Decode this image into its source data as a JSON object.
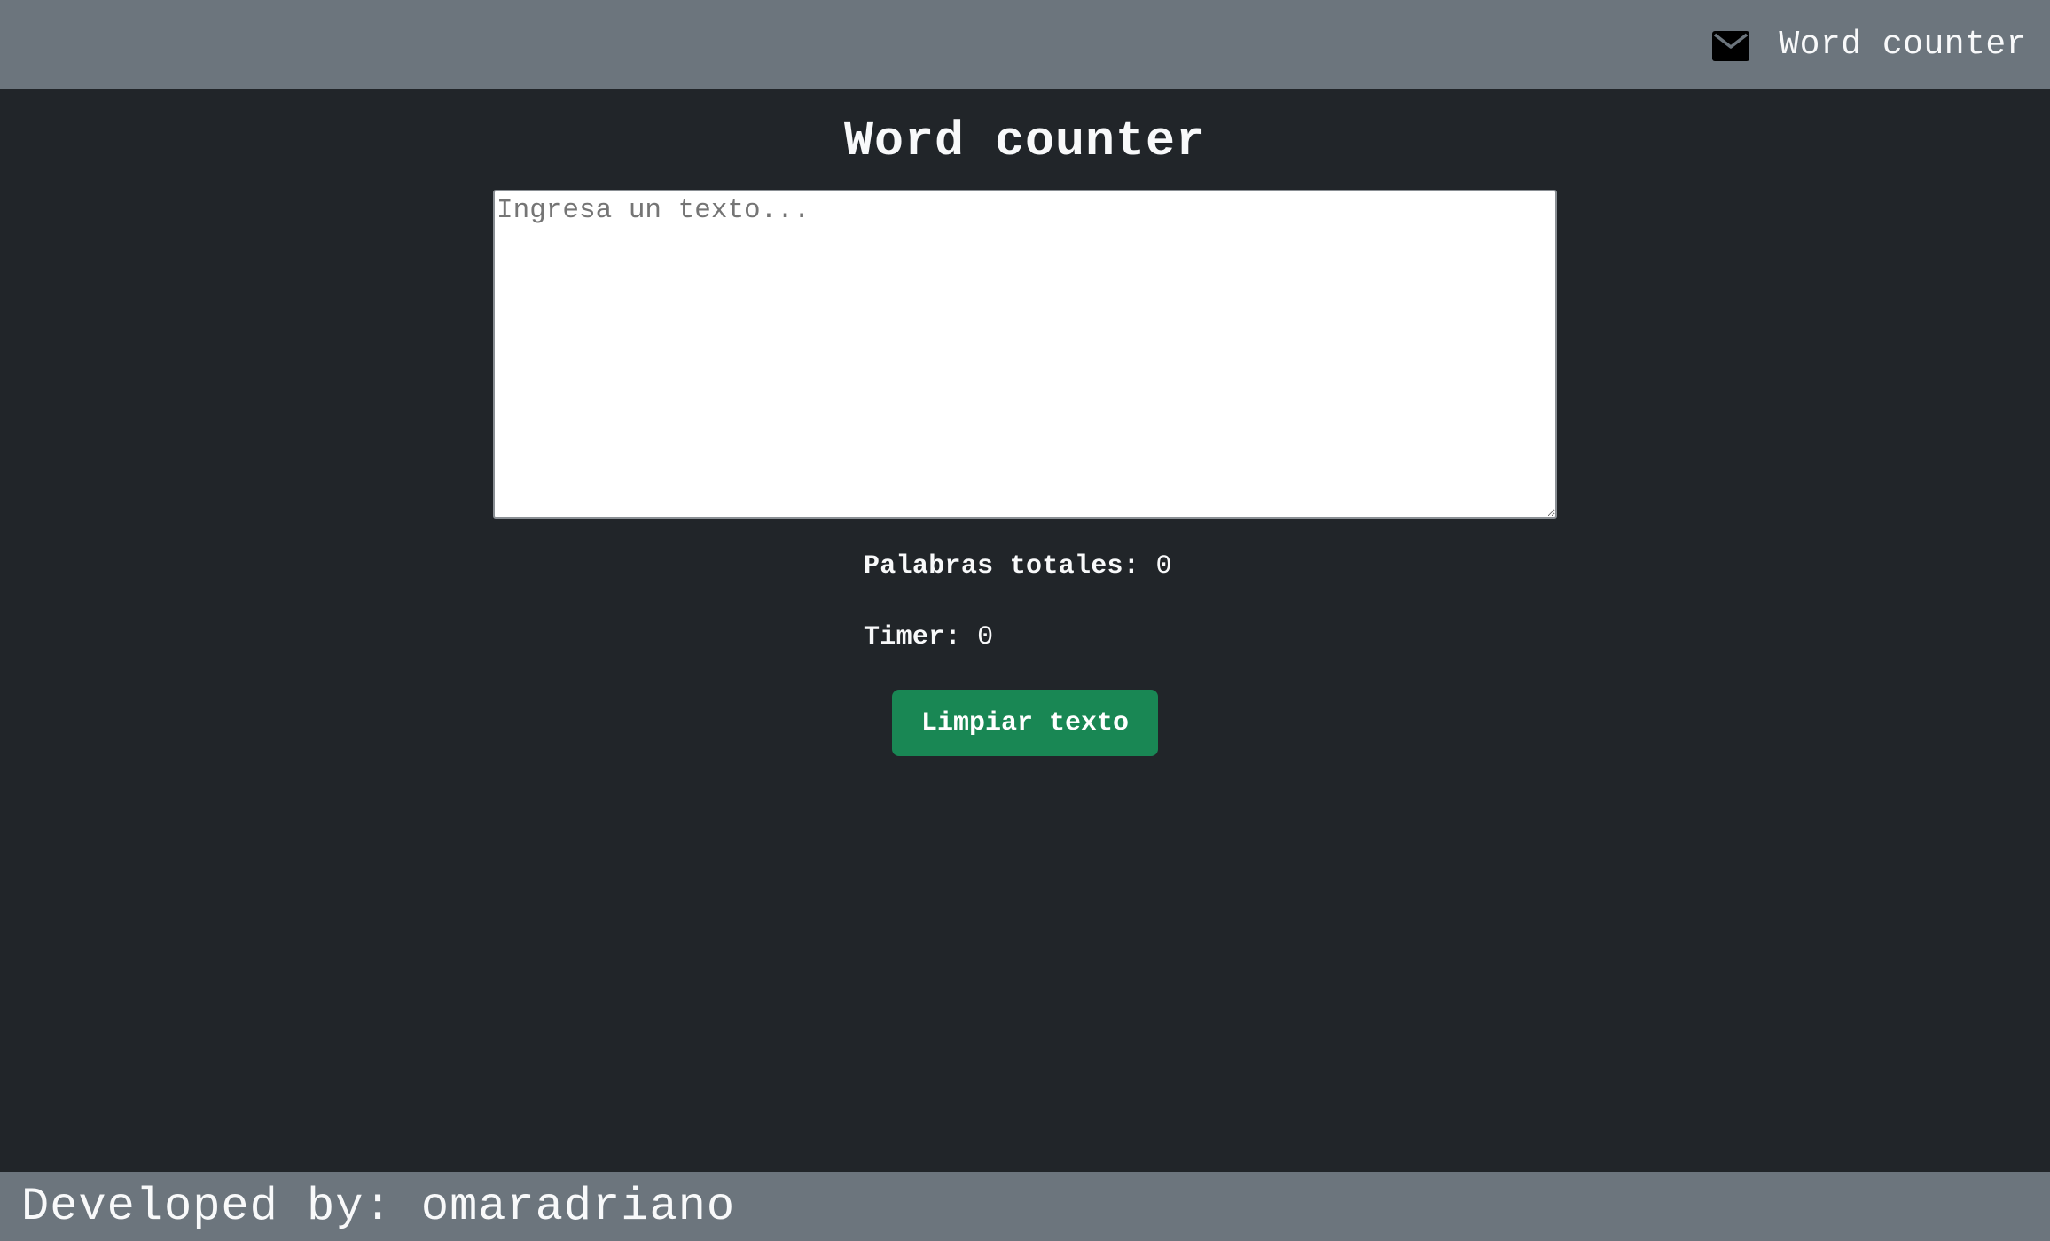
{
  "header": {
    "brand": "Word counter",
    "icon": "mail-icon"
  },
  "main": {
    "title": "Word counter",
    "textarea_placeholder": "Ingresa un texto...",
    "textarea_value": "",
    "words_label": "Palabras totales:",
    "words_count": "0",
    "timer_label": "Timer:",
    "timer_value": "0",
    "clear_button": "Limpiar texto"
  },
  "footer": {
    "credit": "Developed by: omaradriano"
  },
  "colors": {
    "background": "#212529",
    "bars": "#6c757d",
    "button": "#198754",
    "text": "#f8f9fa"
  }
}
